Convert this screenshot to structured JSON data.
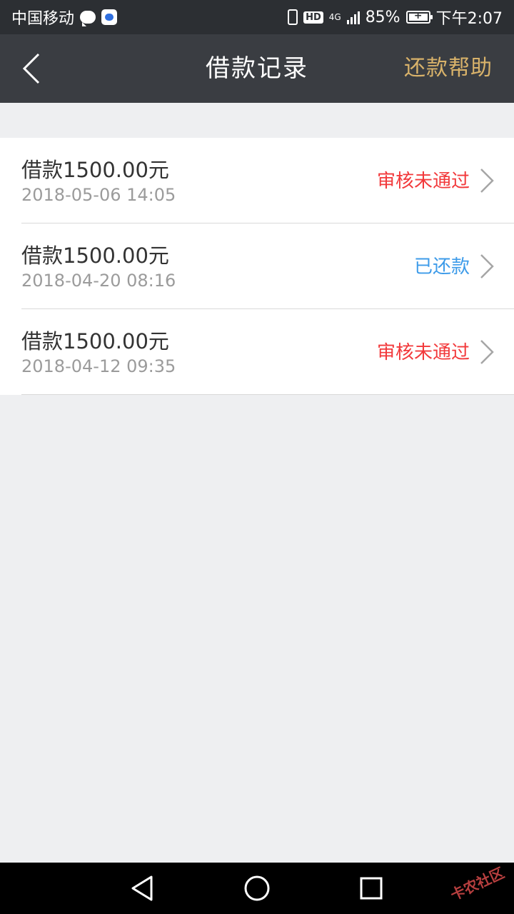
{
  "status_bar": {
    "carrier": "中国移动",
    "hd_label": "HD",
    "network": "4G",
    "battery": "85%",
    "time": "下午2:07"
  },
  "app_bar": {
    "title": "借款记录",
    "help_label": "还款帮助",
    "back_icon": "chevron-left-icon"
  },
  "records": [
    {
      "amount": "借款1500.00元",
      "time": "2018-05-06 14:05",
      "status": "审核未通过",
      "status_color": "#f2393b"
    },
    {
      "amount": "借款1500.00元",
      "time": "2018-04-20 08:16",
      "status": "已还款",
      "status_color": "#3d9be9"
    },
    {
      "amount": "借款1500.00元",
      "time": "2018-04-12 09:35",
      "status": "审核未通过",
      "status_color": "#f2393b"
    }
  ],
  "nav_bar": {
    "back_icon": "triangle-back-icon",
    "home_icon": "circle-home-icon",
    "recent_icon": "square-recent-icon"
  },
  "watermark": {
    "text": "卡农社区"
  },
  "colors": {
    "status_bar_bg": "#2c2f33",
    "app_bar_bg": "#3a3d42",
    "accent_gold": "#d8b26a",
    "page_bg": "#eeeff1"
  }
}
